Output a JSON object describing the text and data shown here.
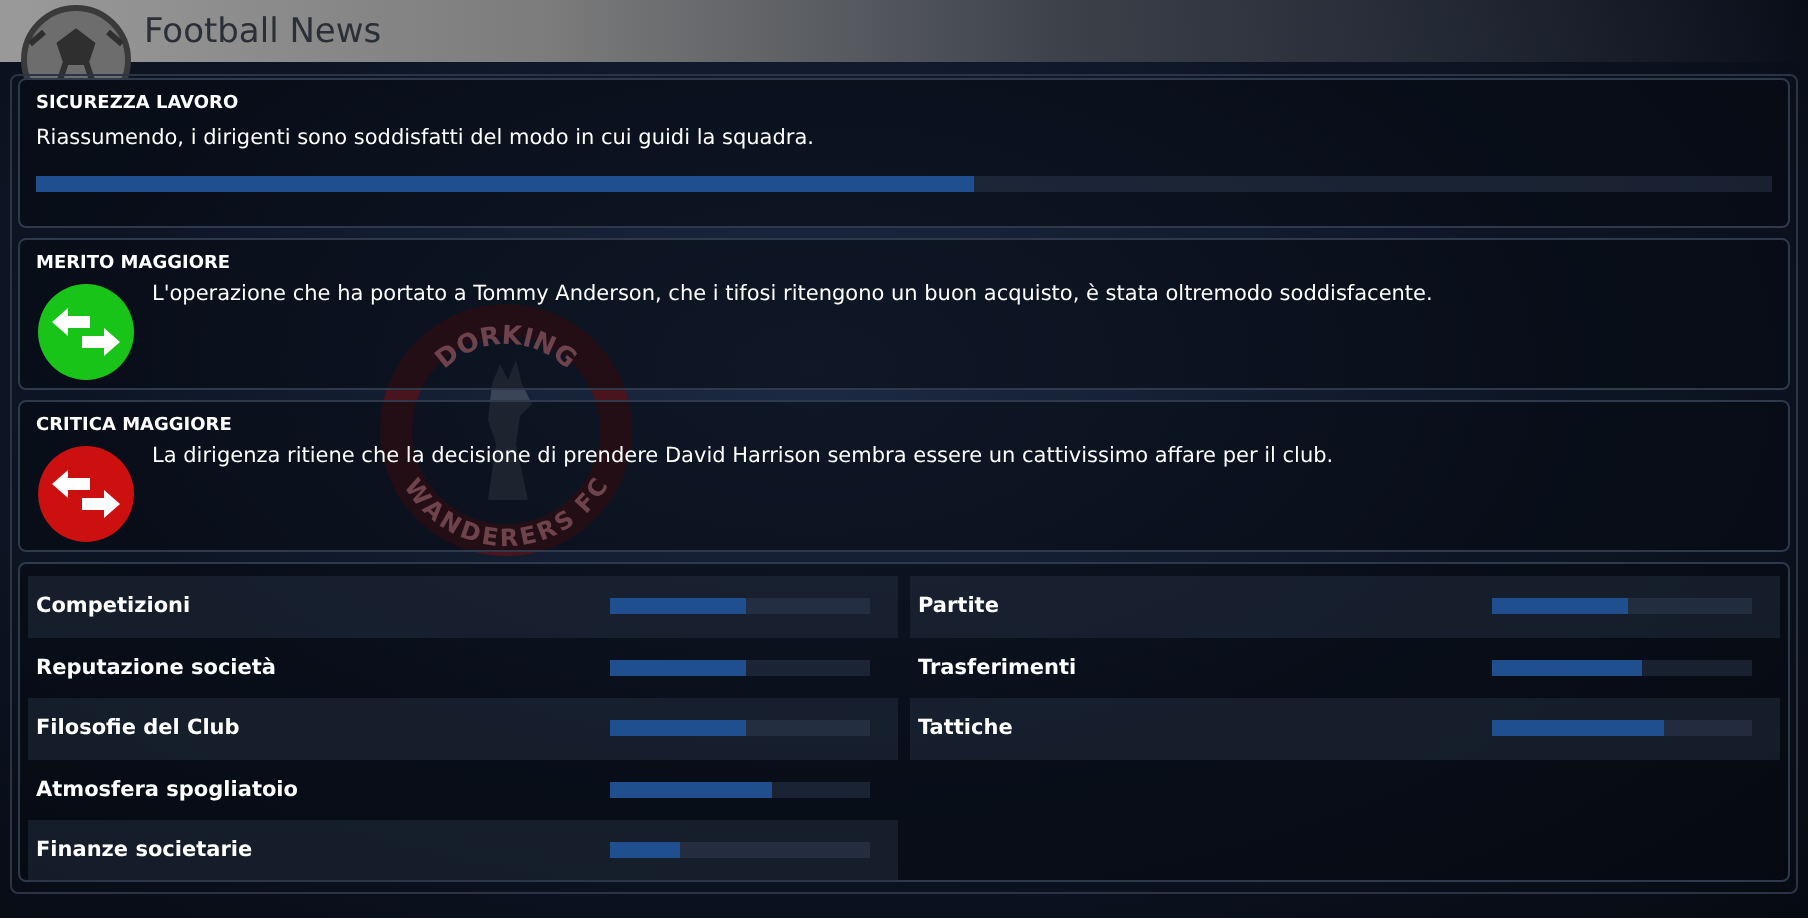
{
  "header": {
    "title": "Football News"
  },
  "crest": {
    "top_text": "DORKING",
    "bottom_text": "WANDERERS FC"
  },
  "job_security": {
    "title": "SICUREZZA LAVORO",
    "text": "Riassumendo, i dirigenti sono soddisfatti del modo in cui guidi la squadra.",
    "level": 0.54
  },
  "highlights": [
    {
      "kind": "positive",
      "title": "MERITO MAGGIORE",
      "text": "L'operazione che ha portato a Tommy Anderson, che i tifosi ritengono un buon acquisto, è stata oltremodo soddisfacente."
    },
    {
      "kind": "negative",
      "title": "CRITICA MAGGIORE",
      "text": "La dirigenza ritiene che la decisione di prendere David Harrison sembra essere un cattivissimo affare per il club."
    }
  ],
  "ratings": {
    "left": [
      {
        "label": "Competizioni",
        "level": 0.52
      },
      {
        "label": "Reputazione società",
        "level": 0.52
      },
      {
        "label": "Filosofie del Club",
        "level": 0.52
      },
      {
        "label": "Atmosfera spogliatoio",
        "level": 0.62
      },
      {
        "label": "Finanze societarie",
        "level": 0.27
      }
    ],
    "right": [
      {
        "label": "Partite",
        "level": 0.52
      },
      {
        "label": "Trasferimenti",
        "level": 0.58
      },
      {
        "label": "Tattiche",
        "level": 0.66
      }
    ]
  }
}
